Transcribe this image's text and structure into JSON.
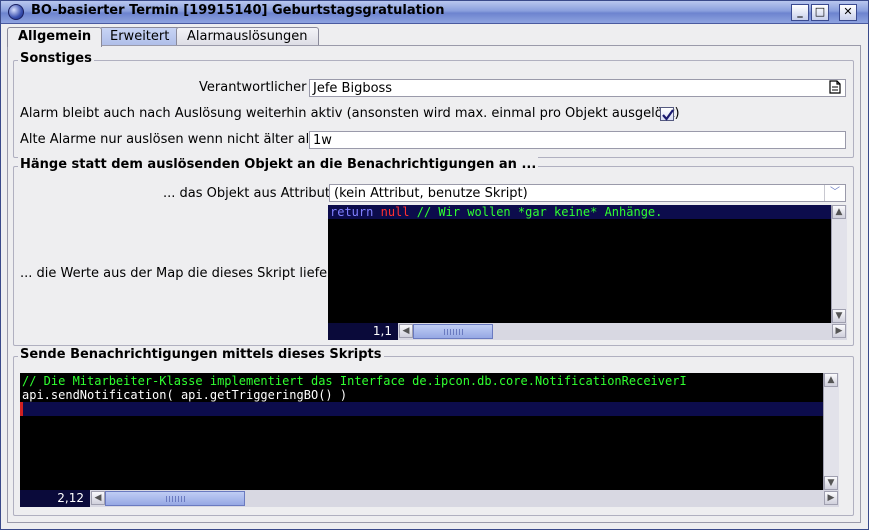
{
  "window": {
    "title": "BO-basierter Termin [19915140] Geburtstagsgratulation",
    "buttons": {
      "minimize": "_",
      "maximize": "□",
      "close": "✕"
    }
  },
  "tabs": [
    {
      "label": "Allgemein"
    },
    {
      "label": "Erweitert"
    },
    {
      "label": "Alarmauslösungen"
    }
  ],
  "sonstiges": {
    "title": "Sonstiges",
    "verantwortlicher_label": "Verantwortlicher",
    "verantwortlicher_value": "Jefe Bigboss",
    "alarm_label": "Alarm bleibt auch nach Auslösung weiterhin aktiv (ansonsten wird max. einmal pro Objekt ausgelöst)",
    "alarm_checked": true,
    "alte_label": "Alte Alarme nur auslösen wenn nicht älter als",
    "alte_value": "1w"
  },
  "anhaenge": {
    "title": "Hänge statt dem auslösenden Objekt an die Benachrichtigungen an ...",
    "attribut_label": "... das Objekt aus Attribut",
    "attribut_value": "(kein Attribut, benutze Skript)",
    "map_label": "... die Werte aus der Map die dieses Skript liefert",
    "script": {
      "kw_return": "return",
      "kw_null": "null",
      "comment": "// Wir wollen *gar keine* Anhänge."
    },
    "cursor_pos": "1,1"
  },
  "sende": {
    "title": "Sende Benachrichtigungen mittels dieses Skripts",
    "script": {
      "line1": "// Die Mitarbeiter-Klasse implementiert das Interface de.ipcon.db.core.NotificationReceiverI",
      "line2": "api.sendNotification( api.getTriggeringBO() )"
    },
    "cursor_pos": "2,12"
  },
  "icons": {
    "document": "document-icon",
    "check": "checkmark-icon",
    "scroll_up": "▲",
    "scroll_down": "▼",
    "scroll_left": "◀",
    "scroll_right": "▶",
    "combo": "﹀"
  }
}
